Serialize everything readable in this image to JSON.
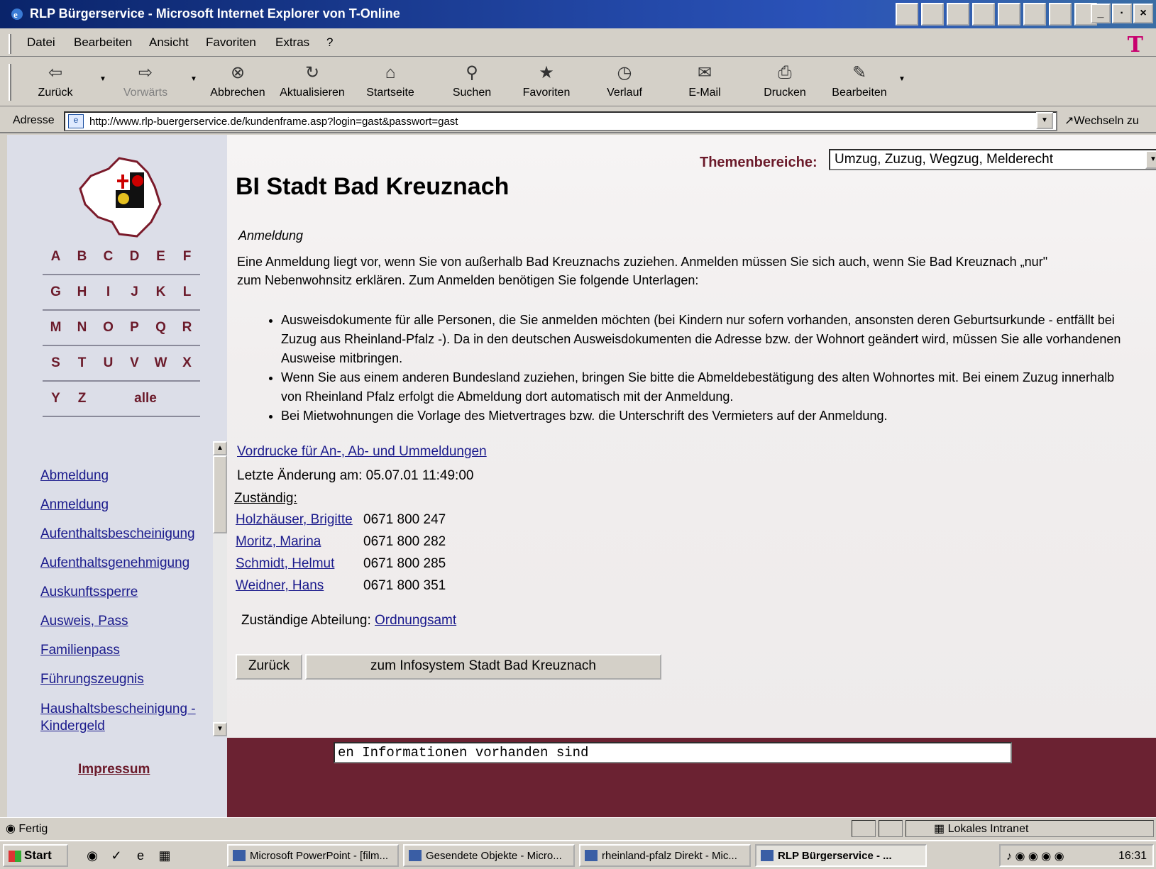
{
  "window": {
    "title": "RLP Bürgerservice - Microsoft Internet Explorer von T-Online",
    "controls": [
      "_",
      "·",
      "×"
    ]
  },
  "menu": [
    "Datei",
    "Bearbeiten",
    "Ansicht",
    "Favoriten",
    "Extras",
    "?"
  ],
  "toolbar": {
    "back": "Zurück",
    "forward": "Vorwärts",
    "stop": "Abbrechen",
    "refresh": "Aktualisieren",
    "home": "Startseite",
    "search": "Suchen",
    "favorites": "Favoriten",
    "history": "Verlauf",
    "mail": "E-Mail",
    "print": "Drucken",
    "edit": "Bearbeiten"
  },
  "address": {
    "label": "Adresse",
    "url": "http://www.rlp-buergerservice.de/kundenframe.asp?login=gast&passwort=gast",
    "go": "Wechseln zu"
  },
  "alphabet": [
    [
      "A",
      "B",
      "C",
      "D",
      "E",
      "F"
    ],
    [
      "G",
      "H",
      "I",
      "J",
      "K",
      "L"
    ],
    [
      "M",
      "N",
      "O",
      "P",
      "Q",
      "R"
    ],
    [
      "S",
      "T",
      "U",
      "V",
      "W",
      "X"
    ],
    [
      "Y",
      "Z",
      "alle"
    ]
  ],
  "left_links": [
    "Abmeldung",
    "Anmeldung",
    "Aufenthaltsbescheinigung",
    "Aufenthaltsgenehmigung",
    "Auskunftssperre",
    "Ausweis, Pass",
    "Familienpass",
    "Führungszeugnis",
    "Haushaltsbescheinigung - Kindergeld"
  ],
  "impressum": "Impressum",
  "themen": {
    "label": "Themenbereiche:",
    "selected": "Umzug, Zuzug, Wegzug, Melderecht"
  },
  "main": {
    "heading": "BI Stadt Bad Kreuznach",
    "subhead": "Anmeldung",
    "intro": "Eine Anmeldung liegt vor, wenn Sie von außerhalb Bad Kreuznachs zuziehen. Anmelden müssen Sie sich auch, wenn Sie Bad Kreuznach „nur\" zum Nebenwohnsitz erklären. Zum Anmelden benötigen Sie folgende Unterlagen:",
    "bullets": [
      "Ausweisdokumente für alle Personen, die Sie anmelden möchten (bei Kindern nur sofern vorhanden, ansonsten deren Geburtsurkunde - entfällt bei Zuzug aus Rheinland-Pfalz -). Da in den deutschen Ausweisdokumenten die Adresse bzw. der Wohnort geändert wird, müssen Sie alle vorhandenen Ausweise mitbringen.",
      "Wenn Sie aus einem anderen Bundesland zuziehen, bringen Sie bitte die Abmeldebestätigung des alten Wohnortes mit. Bei einem Zuzug innerhalb von Rheinland Pfalz erfolgt die Abmeldung dort automatisch mit der Anmeldung.",
      "Bei Mietwohnungen die Vorlage des Mietvertrages bzw. die Unterschrift des Vermieters auf der Anmeldung."
    ],
    "form_link": "Vordrucke für An-, Ab- und Ummeldungen",
    "last_changed": "Letzte Änderung am: 05.07.01 11:49:00",
    "responsible_label": "Zuständig:",
    "contacts": [
      {
        "name": "Holzhäuser, Brigitte",
        "phone": "0671 800 247"
      },
      {
        "name": "Moritz, Marina",
        "phone": "0671 800 282"
      },
      {
        "name": "Schmidt, Helmut",
        "phone": "0671 800 285"
      },
      {
        "name": "Weidner, Hans",
        "phone": "0671 800 351"
      }
    ],
    "department_label": "Zuständige Abteilung:",
    "department": "Ordnungsamt",
    "btn_back": "Zurück",
    "btn_info": "zum Infosystem Stadt Bad Kreuznach"
  },
  "ticker": "en Informationen vorhanden sind",
  "status": {
    "text": "Fertig",
    "zone": "Lokales Intranet"
  },
  "taskbar": {
    "start": "Start",
    "tasks": [
      "Microsoft PowerPoint - [film...",
      "Gesendete Objekte - Micro...",
      "rheinland-pfalz Direkt - Mic...",
      "RLP Bürgerservice - ..."
    ],
    "time": "16:31"
  }
}
